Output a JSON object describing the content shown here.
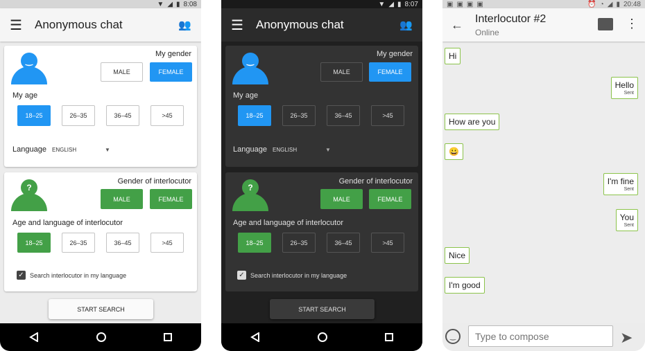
{
  "light": {
    "status": {
      "time": "8:08"
    },
    "appbar": {
      "title": "Anonymous chat"
    },
    "card1": {
      "my_gender": "My gender",
      "male": "MALE",
      "female": "FEMALE",
      "my_age": "My age",
      "ages": [
        "18–25",
        "26–35",
        "36–45",
        ">45"
      ],
      "language_label": "Language",
      "language_value": "ENGLISH"
    },
    "card2": {
      "gender_interlocutor": "Gender of interlocutor",
      "male": "MALE",
      "female": "FEMALE",
      "age_lang": "Age and language of interlocutor",
      "ages": [
        "18–25",
        "26–35",
        "36–45",
        ">45"
      ],
      "search_in_lang": "Search interlocutor in my language"
    },
    "start": "START SEARCH",
    "colors": {
      "blue": "#2196f3",
      "green": "#43a047"
    }
  },
  "dark": {
    "status": {
      "time": "8:07"
    },
    "appbar": {
      "title": "Anonymous chat"
    },
    "card1": {
      "my_gender": "My gender",
      "male": "MALE",
      "female": "FEMALE",
      "my_age": "My age",
      "ages": [
        "18–25",
        "26–35",
        "36–45",
        ">45"
      ],
      "language_label": "Language",
      "language_value": "ENGLISH"
    },
    "card2": {
      "gender_interlocutor": "Gender of interlocutor",
      "male": "MALE",
      "female": "FEMALE",
      "age_lang": "Age and language of interlocutor",
      "ages": [
        "18–25",
        "26–35",
        "36–45",
        ">45"
      ],
      "search_in_lang": "Search interlocutor in my language"
    },
    "start": "START SEARCH"
  },
  "chat": {
    "status": {
      "time": "20:48"
    },
    "title": "Interlocutor #2",
    "subtitle": "Online",
    "messages": [
      {
        "text": "Hi"
      },
      {
        "text": "Hello",
        "status": "Sent"
      },
      {
        "text": "How are you"
      },
      {
        "text": "😀"
      },
      {
        "text": "I'm fine",
        "status": "Sent"
      },
      {
        "text": "You",
        "status": "Sent"
      },
      {
        "text": "Nice"
      },
      {
        "text": "I'm good"
      }
    ],
    "compose_placeholder": "Type to compose",
    "bubble_border": "#8bc34a"
  }
}
